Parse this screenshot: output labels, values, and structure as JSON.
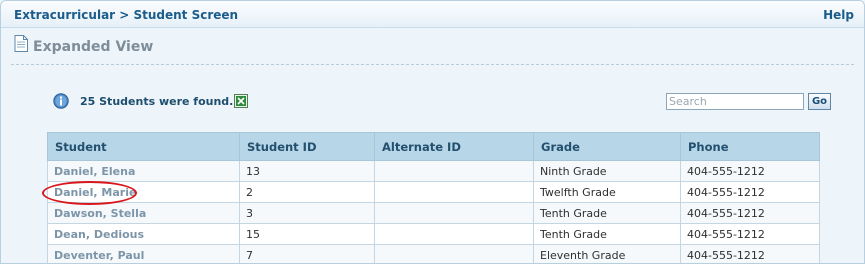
{
  "header": {
    "breadcrumb": "Extracurricular > Student Screen",
    "help_label": "Help"
  },
  "view": {
    "title": "Expanded View",
    "title_icon": "document-icon"
  },
  "results": {
    "summary": "25 Students were found.",
    "info_icon": "info-icon",
    "export_icon": "excel-export-icon"
  },
  "search": {
    "placeholder": "Search",
    "value": "",
    "go_label": "Go"
  },
  "table": {
    "columns": [
      "Student",
      "Student ID",
      "Alternate ID",
      "Grade",
      "Phone"
    ],
    "rows": [
      {
        "student": "Daniel, Elena",
        "student_id": "13",
        "alternate_id": "",
        "grade": "Ninth Grade",
        "phone": "404-555-1212"
      },
      {
        "student": "Daniel, Marie",
        "student_id": "2",
        "alternate_id": "",
        "grade": "Twelfth Grade",
        "phone": "404-555-1212"
      },
      {
        "student": "Dawson, Stella",
        "student_id": "3",
        "alternate_id": "",
        "grade": "Tenth Grade",
        "phone": "404-555-1212"
      },
      {
        "student": "Dean, Dedious",
        "student_id": "15",
        "alternate_id": "",
        "grade": "Tenth Grade",
        "phone": "404-555-1212"
      },
      {
        "student": "Deventer, Paul",
        "student_id": "7",
        "alternate_id": "",
        "grade": "Eleventh Grade",
        "phone": "404-555-1212"
      }
    ]
  },
  "annotation": {
    "highlight_color": "#d9161c"
  }
}
